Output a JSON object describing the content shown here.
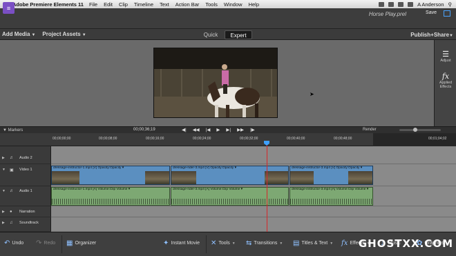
{
  "menubar": {
    "app_name": "Adobe Premiere Elements 11",
    "items": [
      "File",
      "Edit",
      "Clip",
      "Timeline",
      "Text",
      "Action Bar",
      "Tools",
      "Window",
      "Help"
    ],
    "user": "A Anderson"
  },
  "header": {
    "project_title": "Horse Play.prel",
    "save_label": "Save"
  },
  "tabs": {
    "add_media": "Add Media",
    "project_assets": "Project Assets",
    "quick": "Quick",
    "expert": "Expert",
    "publish_share": "Publish+Share"
  },
  "right_panel": {
    "adjust": "Adjust",
    "applied_effects_1": "Applied",
    "applied_effects_2": "Effects"
  },
  "transport": {
    "markers": "Markers",
    "timecode": "00;00;36;19",
    "render": "Render"
  },
  "ruler": {
    "ticks": [
      "00;00;00;00",
      "00;00;08;00",
      "00;00;16;00",
      "00;00;24;00",
      "00;00;32;00",
      "00;00;40;00",
      "00;00;48;00",
      "00;01;04;02"
    ]
  },
  "tracks": {
    "audio2": "Audio 2",
    "video1": "Video 1",
    "audio1": "Audio 1",
    "narration": "Narration",
    "soundtrack": "Soundtrack"
  },
  "clips": {
    "v1": "dressage-instructor-1.mp4 [V]  Opacity:Opacity ▾",
    "v2": "dressage-rider-3.mp4 [V]  Opacity:Opacity ▾",
    "v3": "dressage-instructor-3.mp4 [V]  Opacity:Opacity ▾",
    "a1": "dressage-instructor-1.mp4 [A]  Volume:Clip Volume ▾",
    "a2": "dressage-rider-3.mp4 [A]  Volume:Clip Volume ▾",
    "a3": "dressage-instructor-3.mp4 [A]  Volume:Clip Volume ▾"
  },
  "actionbar": {
    "undo": "Undo",
    "redo": "Redo",
    "organizer": "Organizer",
    "instant_movie": "Instant Movie",
    "tools": "Tools",
    "transitions": "Transitions",
    "titles_text": "Titles & Text",
    "effects": "Effects",
    "music": "Music",
    "graphics": "Graphics"
  },
  "watermark": "GHOSTXX.COM",
  "colors": {
    "accent": "#3ea0ff",
    "playhead": "#d6262a",
    "work_area": "#e07a18",
    "video_clip": "#5b8fc0",
    "audio_clip": "#7da873"
  }
}
